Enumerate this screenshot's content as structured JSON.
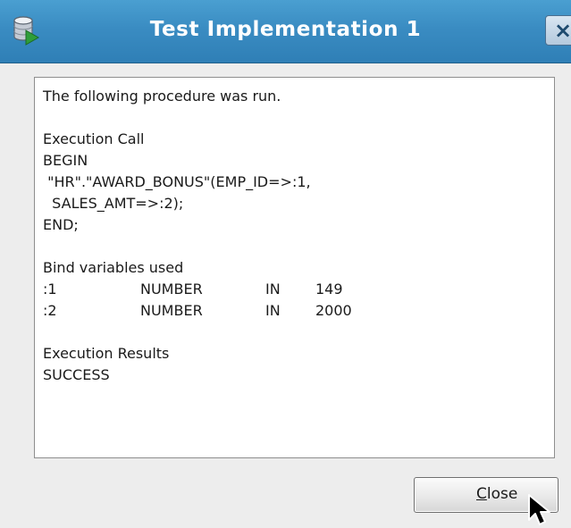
{
  "dialog": {
    "title": "Test Implementation 1",
    "close_glyph": "×",
    "icon": "database-run-icon"
  },
  "content": {
    "intro": "The following procedure was run.",
    "execution_call_heading": "Execution Call",
    "code_lines": [
      "BEGIN",
      " \"HR\".\"AWARD_BONUS\"(EMP_ID=>:1,",
      "  SALES_AMT=>:2);",
      "END;"
    ],
    "bind_heading": "Bind variables used",
    "bind_variables": [
      {
        "name": ":1",
        "type": "NUMBER",
        "mode": "IN",
        "value": "149"
      },
      {
        "name": ":2",
        "type": "NUMBER",
        "mode": "IN",
        "value": "2000"
      }
    ],
    "results_heading": "Execution Results",
    "result": "SUCCESS"
  },
  "buttons": {
    "close_mnemonic": "C",
    "close_rest": "lose"
  },
  "colors": {
    "titlebar": "#3a8cc2",
    "title_text": "#ffffff",
    "panel_background": "#ffffff",
    "window_background": "#ededed"
  }
}
